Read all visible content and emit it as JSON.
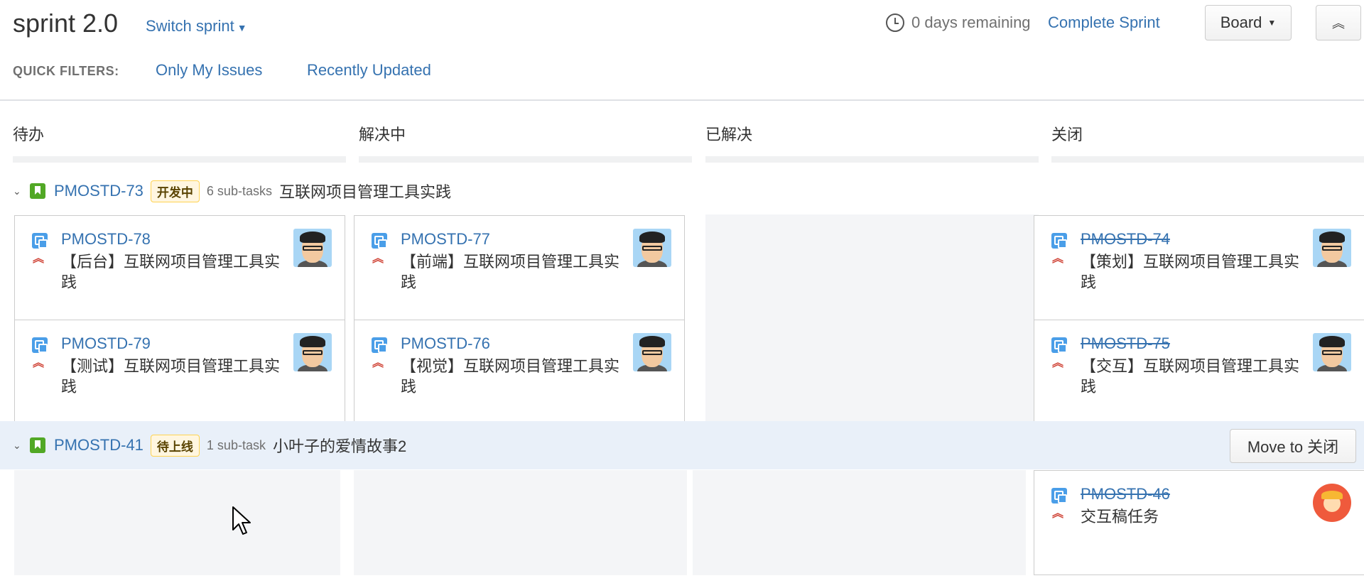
{
  "header": {
    "sprint_name": "sprint 2.0",
    "switch_sprint": "Switch sprint",
    "remaining": "0 days remaining",
    "complete_sprint": "Complete Sprint",
    "board_button": "Board"
  },
  "quick_filters": {
    "label": "QUICK FILTERS:",
    "items": [
      "Only My Issues",
      "Recently Updated"
    ]
  },
  "columns": [
    "待办",
    "解决中",
    "已解决",
    "关闭"
  ],
  "swimlanes": [
    {
      "key": "PMOSTD-73",
      "status": "开发中",
      "subtasks": "6 sub-tasks",
      "summary": "互联网项目管理工具实践"
    },
    {
      "key": "PMOSTD-41",
      "status": "待上线",
      "subtasks": "1 sub-task",
      "summary": "小叶子的爱情故事2",
      "move_button": "Move to 关闭"
    }
  ],
  "cards": [
    {
      "key": "PMOSTD-78",
      "summary": "【后台】互联网项目管理工具实践",
      "done": false
    },
    {
      "key": "PMOSTD-79",
      "summary": "【测试】互联网项目管理工具实践",
      "done": false
    },
    {
      "key": "PMOSTD-77",
      "summary": "【前端】互联网项目管理工具实践",
      "done": false
    },
    {
      "key": "PMOSTD-76",
      "summary": "【视觉】互联网项目管理工具实践",
      "done": false
    },
    {
      "key": "PMOSTD-74",
      "summary": "【策划】互联网项目管理工具实践",
      "done": true
    },
    {
      "key": "PMOSTD-75",
      "summary": "【交互】互联网项目管理工具实践",
      "done": true
    },
    {
      "key": "PMOSTD-46",
      "summary": "交互稿任务",
      "done": true
    }
  ],
  "colors": {
    "link": "#3572b0",
    "story_icon": "#51a825",
    "subtask_icon": "#4a9ee8",
    "priority": "#d04437",
    "lozenge_bg": "#fff6e0",
    "lozenge_border": "#ffd351",
    "highlight_lane": "#e9f0f9"
  },
  "icons": {
    "clock": "clock-icon",
    "story": "story-icon",
    "subtask": "subtask-icon",
    "priority": "priority-high-icon",
    "chevron": "chevron-down-icon",
    "collapse": "double-chevron-up-icon"
  }
}
